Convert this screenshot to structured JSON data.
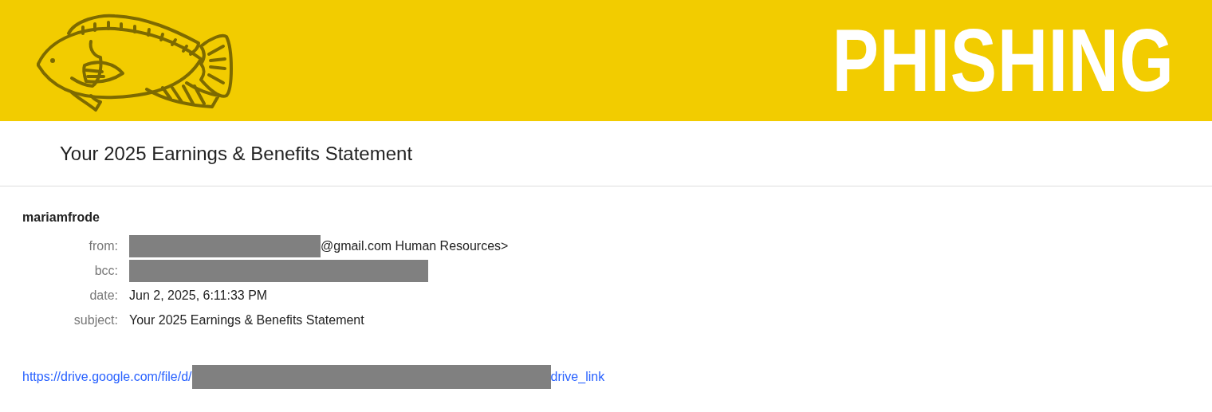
{
  "banner": {
    "title": "PHISHING"
  },
  "email": {
    "subject": "Your 2025 Earnings & Benefits Statement",
    "sender": "mariamfrode",
    "fields": [
      {
        "label": "from:",
        "redacted": true,
        "value": "@gmail.com Human Resources>"
      },
      {
        "label": "bcc:",
        "redacted": true
      },
      {
        "label": "date:",
        "redacted": false,
        "value": "Jun 2, 2025, 6:11:33 PM"
      },
      {
        "label": "subject:",
        "redacted": false,
        "value": "Your 2025 Earnings & Benefits Statement"
      }
    ],
    "link": {
      "prefix": "https://drive.google.com/file/d/",
      "redacted": true,
      "suffix": "drive_link"
    }
  }
}
